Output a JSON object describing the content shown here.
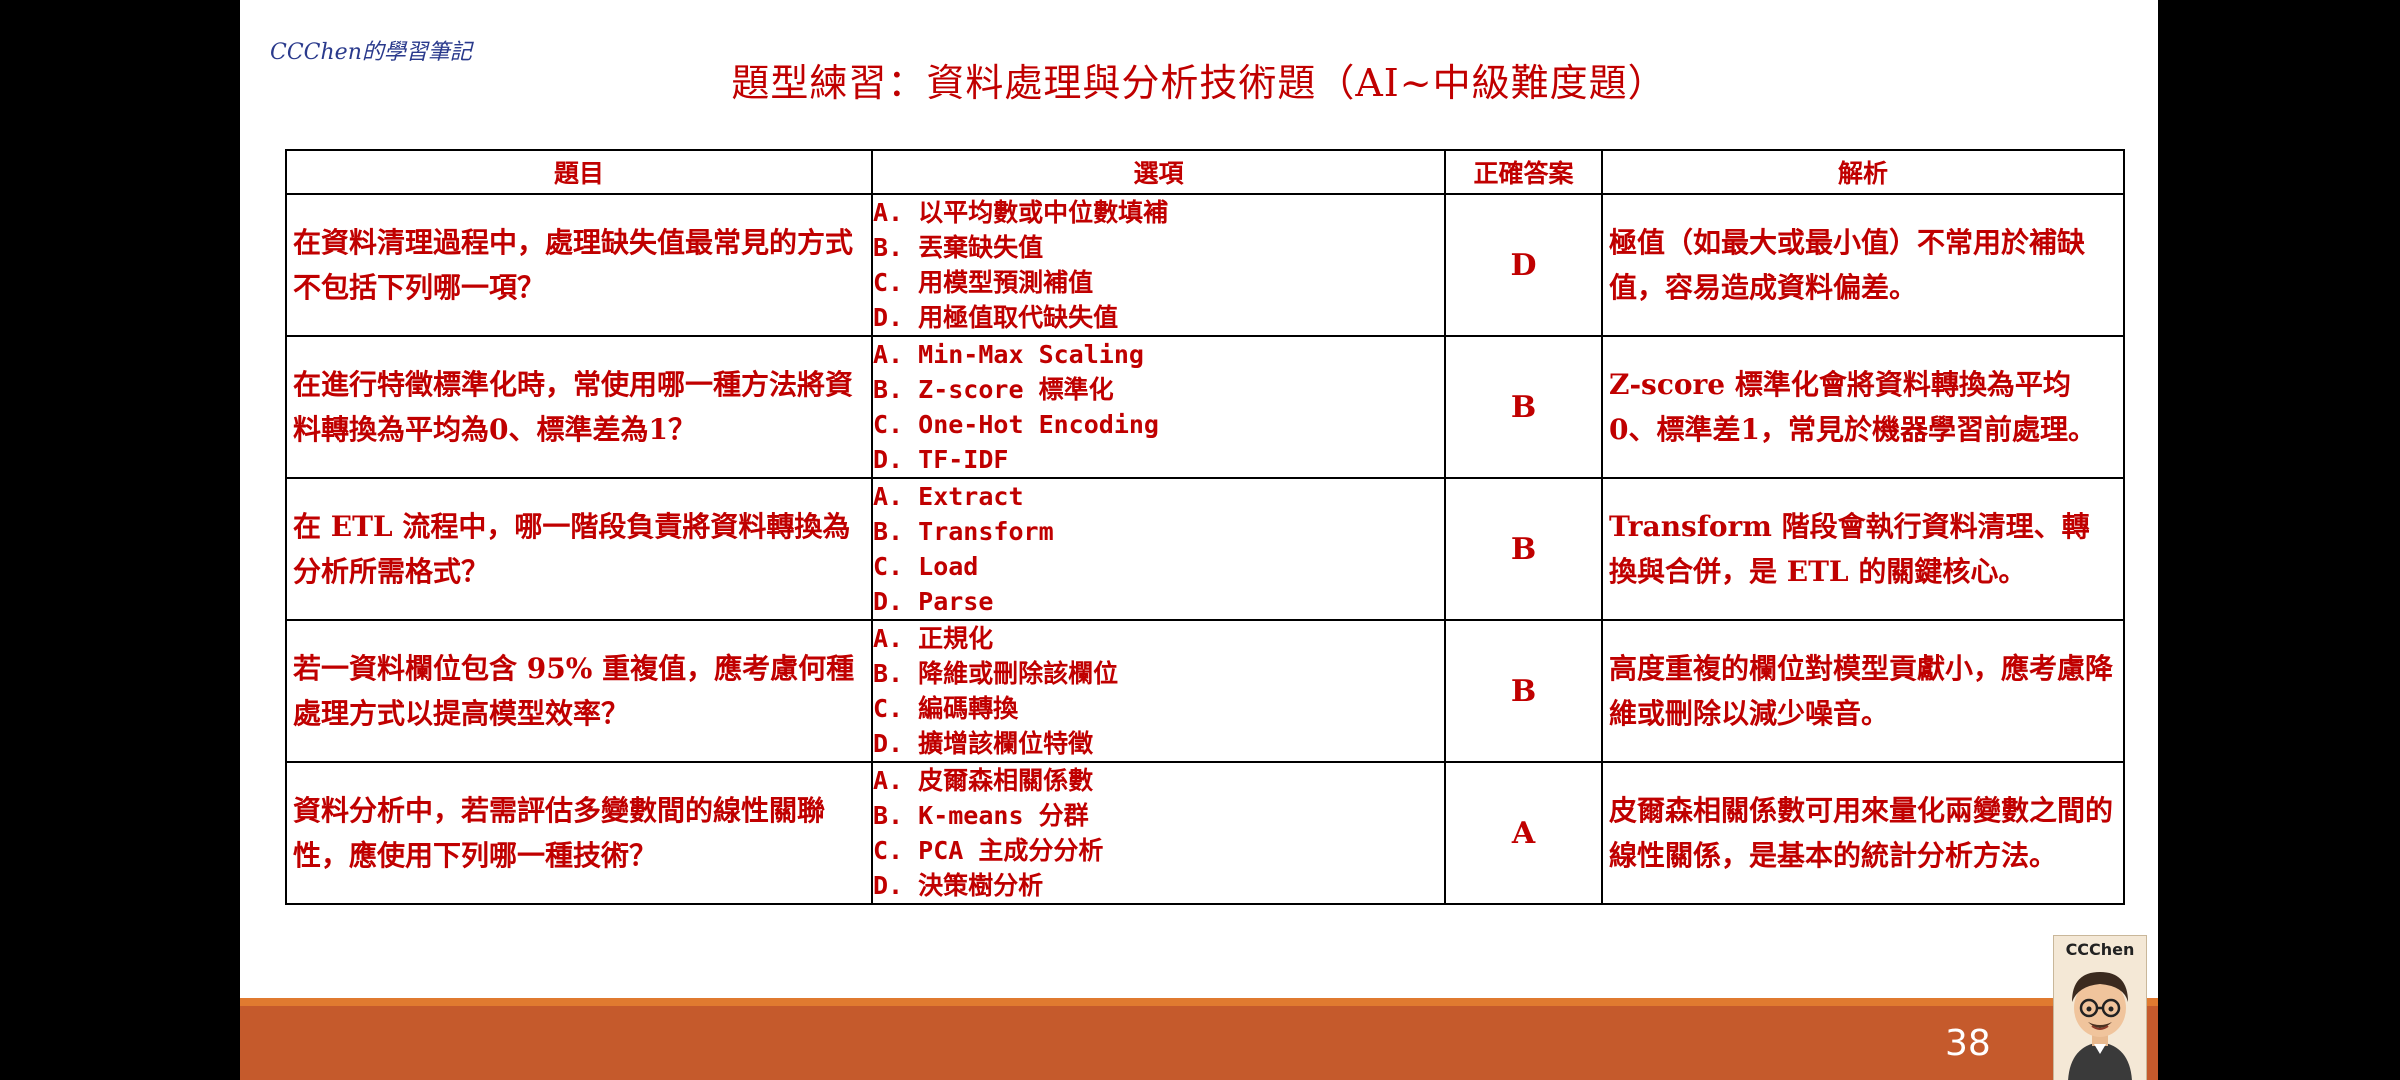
{
  "header": {
    "logo": "CCChen的學習筆記",
    "title": "題型練習：資料處理與分析技術題（AI~中級難度題）"
  },
  "table": {
    "headers": [
      "題目",
      "選項",
      "正確答案",
      "解析"
    ],
    "rows": [
      {
        "question": "在資料清理過程中，處理缺失值最常見的方式不包括下列哪一項？",
        "options": [
          "A. 以平均數或中位數填補",
          "B. 丟棄缺失值",
          "C. 用模型預測補值",
          "D. 用極值取代缺失值"
        ],
        "answer": "D",
        "explanation": "極值（如最大或最小值）不常用於補缺值，容易造成資料偏差。"
      },
      {
        "question": "在進行特徵標準化時，常使用哪一種方法將資料轉換為平均為0、標準差為1？",
        "options": [
          "A. Min-Max Scaling",
          "B. Z-score 標準化",
          "C. One-Hot Encoding",
          "D. TF-IDF"
        ],
        "answer": "B",
        "explanation": "Z-score 標準化會將資料轉換為平均0、標準差1，常見於機器學習前處理。"
      },
      {
        "question": "在 ETL 流程中，哪一階段負責將資料轉換為分析所需格式？",
        "options": [
          "A. Extract",
          "B. Transform",
          "C. Load",
          "D. Parse"
        ],
        "answer": "B",
        "explanation": "Transform 階段會執行資料清理、轉換與合併，是 ETL 的關鍵核心。"
      },
      {
        "question": "若一資料欄位包含 95% 重複值，應考慮何種處理方式以提高模型效率？",
        "options": [
          "A. 正規化",
          "B. 降維或刪除該欄位",
          "C. 編碼轉換",
          "D. 擴增該欄位特徵"
        ],
        "answer": "B",
        "explanation": "高度重複的欄位對模型貢獻小，應考慮降維或刪除以減少噪音。"
      },
      {
        "question": "資料分析中，若需評估多變數間的線性關聯性，應使用下列哪一種技術？",
        "options": [
          "A. 皮爾森相關係數",
          "B. K-means 分群",
          "C. PCA 主成分分析",
          "D. 決策樹分析"
        ],
        "answer": "A",
        "explanation": "皮爾森相關係數可用來量化兩變數之間的線性關係，是基本的統計分析方法。"
      }
    ]
  },
  "footer": {
    "page_number": "38",
    "avatar_label": "CCChen"
  },
  "colors": {
    "text_red": "#c00000",
    "footer_bar": "#c55a2c",
    "background": "#000000"
  }
}
